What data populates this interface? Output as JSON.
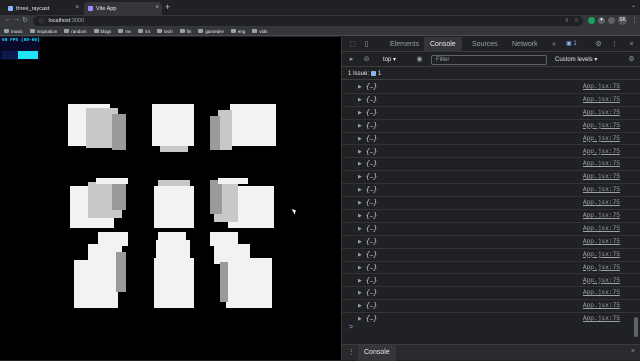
{
  "browser": {
    "tabs": [
      {
        "title": "three_raycast",
        "active": false
      },
      {
        "title": "Vite App",
        "active": true
      }
    ],
    "new_tab": "+",
    "address_host": "localhost",
    "address_port": ":3000",
    "profile_initial": "SK",
    "bookmarks": [
      "music",
      "inspiration",
      "random",
      "blogs",
      "mv",
      "int",
      "tech",
      "fin",
      "gamedev",
      "eng",
      "vids"
    ]
  },
  "viewport": {
    "fps_text": "60 FPS (50-60)",
    "fps_level": 0.56,
    "background": "#000000"
  },
  "devtools": {
    "tabs": [
      "Elements",
      "Console",
      "Sources",
      "Network"
    ],
    "active_tab": "Console",
    "more_tabs": "»",
    "issues_count": "1",
    "context": "top",
    "filter_placeholder": "Filter",
    "levels": "Custom levels ▾",
    "issue_bar": {
      "label": "1 Issue:",
      "count": "1"
    },
    "log_entries": [
      {
        "text": "{…}",
        "source": "App.jsx:75"
      },
      {
        "text": "{…}",
        "source": "App.jsx:75"
      },
      {
        "text": "{…}",
        "source": "App.jsx:75"
      },
      {
        "text": "{…}",
        "source": "App.jsx:75"
      },
      {
        "text": "{…}",
        "source": "App.jsx:75"
      },
      {
        "text": "{…}",
        "source": "App.jsx:75"
      },
      {
        "text": "{…}",
        "source": "App.jsx:75"
      },
      {
        "text": "{…}",
        "source": "App.jsx:75"
      },
      {
        "text": "{…}",
        "source": "App.jsx:75"
      },
      {
        "text": "{…}",
        "source": "App.jsx:75"
      },
      {
        "text": "{…}",
        "source": "App.jsx:75"
      },
      {
        "text": "{…}",
        "source": "App.jsx:75"
      },
      {
        "text": "{…}",
        "source": "App.jsx:75"
      },
      {
        "text": "{…}",
        "source": "App.jsx:75"
      },
      {
        "text": "{…}",
        "source": "App.jsx:75"
      },
      {
        "text": "{…}",
        "source": "App.jsx:75"
      },
      {
        "text": "{…}",
        "source": "App.jsx:75"
      },
      {
        "text": "{…}",
        "source": "App.jsx:75"
      },
      {
        "text": "{…}",
        "source": "App.jsx:75"
      }
    ],
    "prompt": ">",
    "drawer_tab": "Console"
  },
  "colors": {
    "accent": "#8ab4f8",
    "fps_cyan": "#1ee6f5",
    "cube_face": "#f2f2f2"
  }
}
